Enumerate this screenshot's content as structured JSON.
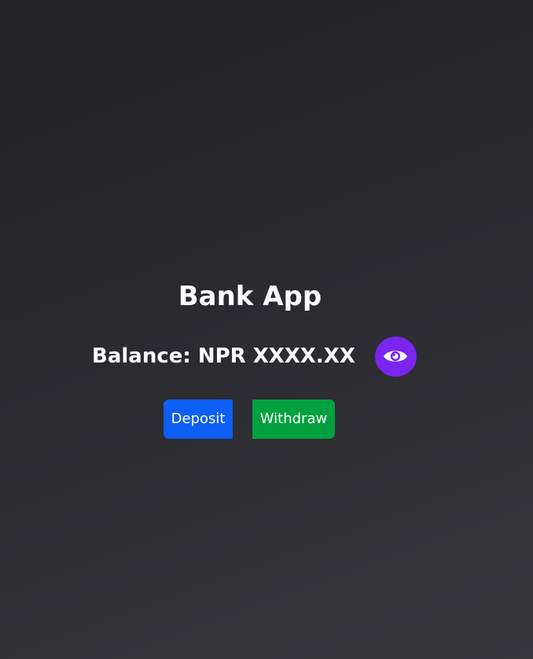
{
  "app": {
    "title": "Bank App"
  },
  "balance": {
    "text": "Balance: NPR XXXX.XX",
    "toggle_icon": "eye-icon"
  },
  "actions": {
    "deposit_label": "Deposit",
    "withdraw_label": "Withdraw"
  },
  "colors": {
    "background": "#26262b",
    "eye_button": "#7a26f0",
    "deposit_button": "#0d5ff5",
    "withdraw_button": "#02a13f",
    "text": "#ffffff"
  }
}
